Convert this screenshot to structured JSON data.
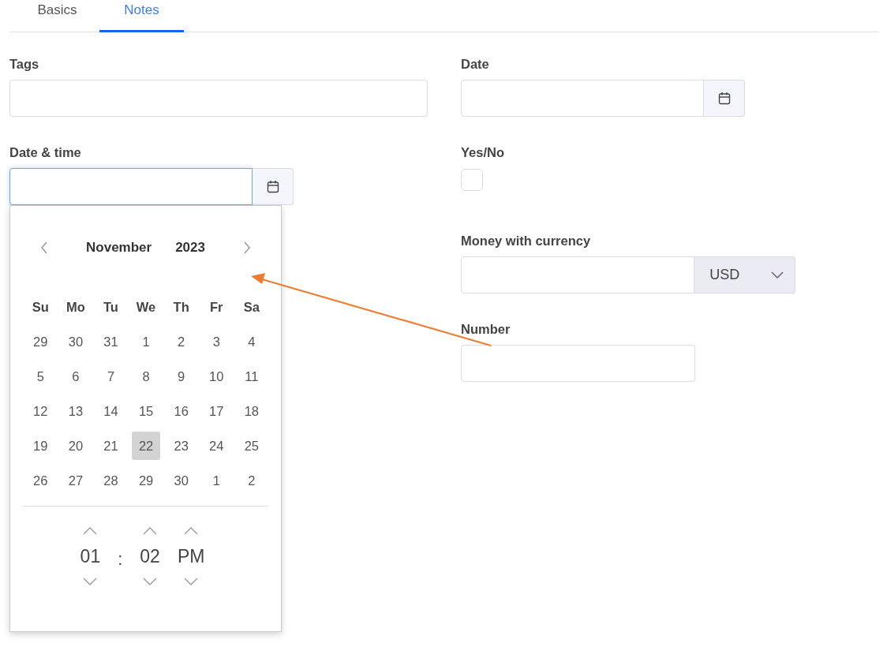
{
  "tabs": [
    {
      "label": "Basics",
      "selected": false
    },
    {
      "label": "Notes",
      "selected": true
    }
  ],
  "left_fields": [
    {
      "kind": "text",
      "label": "Tags"
    },
    {
      "kind": "datetime",
      "label": "Date & time",
      "focused": true
    }
  ],
  "right_fields": [
    {
      "kind": "date",
      "label": "Date"
    },
    {
      "kind": "checkbox",
      "label": "Yes/No",
      "checked": false
    },
    {
      "kind": "money",
      "label": "Money with currency",
      "currency": "USD"
    },
    {
      "kind": "text",
      "label": "Number"
    }
  ],
  "date_picker": {
    "month": "November",
    "year": "2023",
    "weekdays": [
      "Su",
      "Mo",
      "Tu",
      "We",
      "Th",
      "Fr",
      "Sa"
    ],
    "weeks": [
      [
        {
          "day": "29",
          "selected": false
        },
        {
          "day": "30",
          "selected": false
        },
        {
          "day": "31",
          "selected": false
        },
        {
          "day": "1",
          "selected": false
        },
        {
          "day": "2",
          "selected": false
        },
        {
          "day": "3",
          "selected": false
        },
        {
          "day": "4",
          "selected": false
        }
      ],
      [
        {
          "day": "5",
          "selected": false
        },
        {
          "day": "6",
          "selected": false
        },
        {
          "day": "7",
          "selected": false
        },
        {
          "day": "8",
          "selected": false
        },
        {
          "day": "9",
          "selected": false
        },
        {
          "day": "10",
          "selected": false
        },
        {
          "day": "11",
          "selected": false
        }
      ],
      [
        {
          "day": "12",
          "selected": false
        },
        {
          "day": "13",
          "selected": false
        },
        {
          "day": "14",
          "selected": false
        },
        {
          "day": "15",
          "selected": false
        },
        {
          "day": "16",
          "selected": false
        },
        {
          "day": "17",
          "selected": false
        },
        {
          "day": "18",
          "selected": false
        }
      ],
      [
        {
          "day": "19",
          "selected": false
        },
        {
          "day": "20",
          "selected": false
        },
        {
          "day": "21",
          "selected": false
        },
        {
          "day": "22",
          "selected": true
        },
        {
          "day": "23",
          "selected": false
        },
        {
          "day": "24",
          "selected": false
        },
        {
          "day": "25",
          "selected": false
        }
      ],
      [
        {
          "day": "26",
          "selected": false
        },
        {
          "day": "27",
          "selected": false
        },
        {
          "day": "28",
          "selected": false
        },
        {
          "day": "29",
          "selected": false
        },
        {
          "day": "30",
          "selected": false
        },
        {
          "day": "1",
          "selected": false
        },
        {
          "day": "2",
          "selected": false
        }
      ]
    ],
    "time": {
      "hour": "01",
      "separator": ":",
      "minute": "02",
      "period": "PM"
    }
  }
}
